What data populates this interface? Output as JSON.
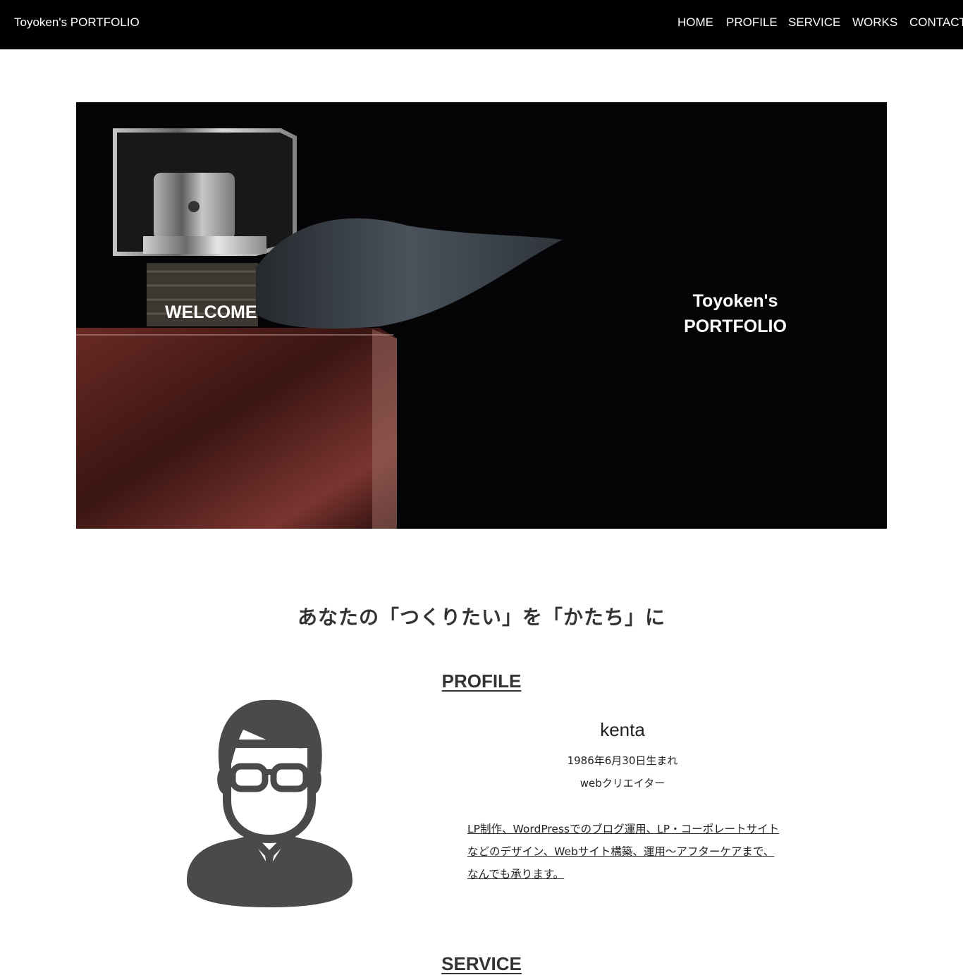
{
  "header": {
    "logo": "Toyoken's PORTFOLIO",
    "nav": [
      "HOME",
      "PROFILE",
      "SERVICE",
      "WORKS",
      "CONTACT"
    ]
  },
  "hero": {
    "welcome": "WELCOME",
    "title_line1": "Toyoken's",
    "title_line2": "PORTFOLIO"
  },
  "tagline": "あなたの「つくりたい」を「かたち」に",
  "profile": {
    "heading": "PROFILE",
    "name": "kenta",
    "birth": "1986年6月30日生まれ",
    "job": "webクリエイター",
    "description": "LP制作、WordPressでのブログ運用、LP・コーポレートサイトなどのデザイン、Webサイト構築、運用〜アフターケアまで、なんでも承ります。"
  },
  "service": {
    "heading": "SERVICE"
  },
  "colors": {
    "header_bg": "#000000",
    "hero_bg": "#050507",
    "text": "#333333",
    "avatar": "#4a4a4a"
  }
}
